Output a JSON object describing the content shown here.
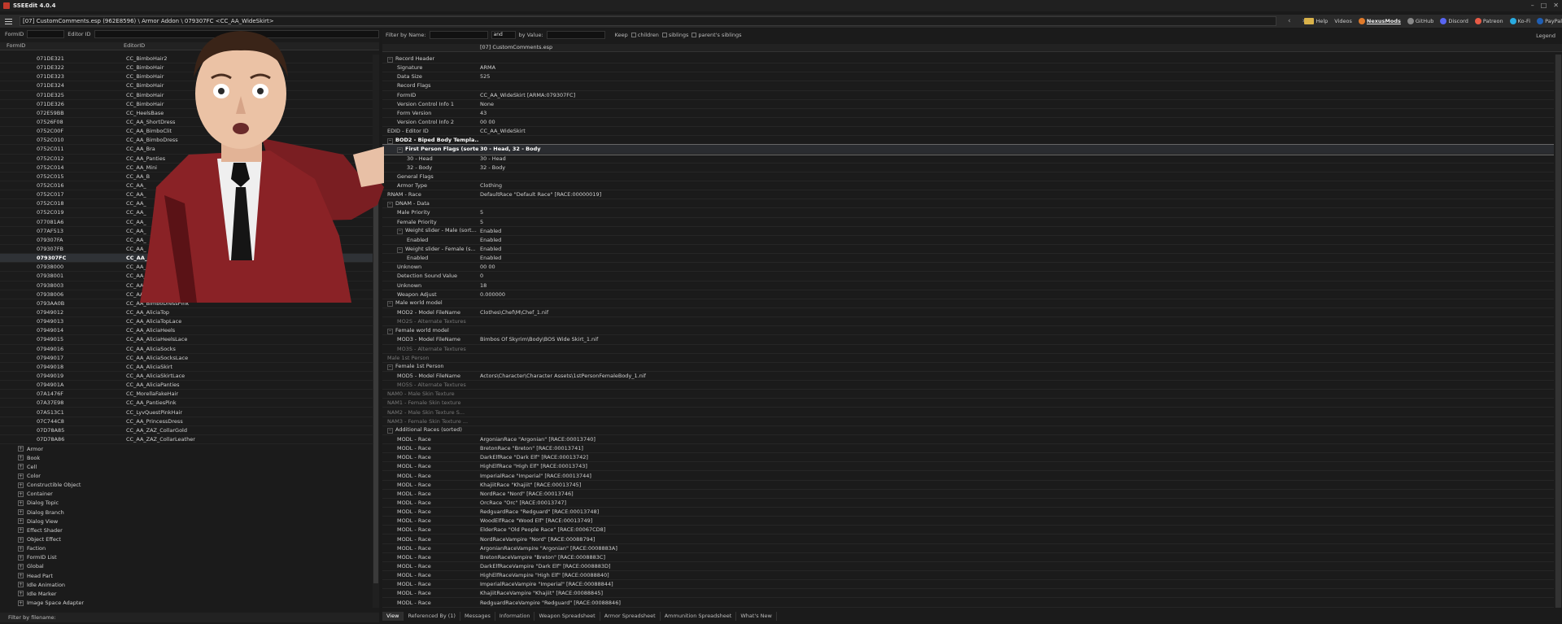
{
  "window": {
    "title": "SSEEdit 4.0.4"
  },
  "path": "[07] CustomComments.esp (962E8596) \\ Armor Addon \\ 079307FC <CC_AA_WideSkirt>",
  "top_links": [
    "Help",
    "Videos",
    "NexusMods",
    "GitHub",
    "Discord",
    "Patreon",
    "Ko-Fi",
    "PayPal"
  ],
  "left": {
    "formid_label": "FormID",
    "editorid_label": "Editor ID",
    "col_formid": "FormID",
    "col_editorid": "EditorID",
    "rows": [
      {
        "fid": "071DE321",
        "eid": "CC_BimboHair2"
      },
      {
        "fid": "071DE322",
        "eid": "CC_BimboHair"
      },
      {
        "fid": "071DE323",
        "eid": "CC_BimboHair"
      },
      {
        "fid": "071DE324",
        "eid": "CC_BimboHair"
      },
      {
        "fid": "071DE325",
        "eid": "CC_BimboHair"
      },
      {
        "fid": "071DE326",
        "eid": "CC_BimboHair"
      },
      {
        "fid": "072E59BB",
        "eid": "CC_HeelsBase"
      },
      {
        "fid": "07526F08",
        "eid": "CC_AA_ShortDress"
      },
      {
        "fid": "0752C00F",
        "eid": "CC_AA_BimboClit"
      },
      {
        "fid": "0752C010",
        "eid": "CC_AA_BimboDress"
      },
      {
        "fid": "0752C011",
        "eid": "CC_AA_Bra"
      },
      {
        "fid": "0752C012",
        "eid": "CC_AA_Panties"
      },
      {
        "fid": "0752C014",
        "eid": "CC_AA_Mini"
      },
      {
        "fid": "0752C015",
        "eid": "CC_AA_B"
      },
      {
        "fid": "0752C016",
        "eid": "CC_AA_"
      },
      {
        "fid": "0752C017",
        "eid": "CC_AA_"
      },
      {
        "fid": "0752C018",
        "eid": "CC_AA_"
      },
      {
        "fid": "0752C019",
        "eid": "CC_AA_"
      },
      {
        "fid": "077081A6",
        "eid": "CC_AA_"
      },
      {
        "fid": "077AF513",
        "eid": "CC_AA_"
      },
      {
        "fid": "079307FA",
        "eid": "CC_AA_"
      },
      {
        "fid": "079307FB",
        "eid": "CC_AA_"
      },
      {
        "fid": "079307FC",
        "eid": "CC_AA_",
        "selected": true
      },
      {
        "fid": "07938000",
        "eid": "CC_AA_"
      },
      {
        "fid": "07938001",
        "eid": "CC_AA_"
      },
      {
        "fid": "07938003",
        "eid": "CC_AA_"
      },
      {
        "fid": "07938006",
        "eid": "CC_AA_"
      },
      {
        "fid": "0793AA0B",
        "eid": "CC_AA_BimboDressPink"
      },
      {
        "fid": "07949012",
        "eid": "CC_AA_AliciaTop"
      },
      {
        "fid": "07949013",
        "eid": "CC_AA_AliciaTopLace"
      },
      {
        "fid": "07949014",
        "eid": "CC_AA_AliciaHeels"
      },
      {
        "fid": "07949015",
        "eid": "CC_AA_AliciaHeelsLace"
      },
      {
        "fid": "07949016",
        "eid": "CC_AA_AliciaSocks"
      },
      {
        "fid": "07949017",
        "eid": "CC_AA_AliciaSocksLace"
      },
      {
        "fid": "07949018",
        "eid": "CC_AA_AliciaSkirt"
      },
      {
        "fid": "07949019",
        "eid": "CC_AA_AliciaSkirtLace"
      },
      {
        "fid": "0794901A",
        "eid": "CC_AA_AliciaPanties"
      },
      {
        "fid": "07A1476F",
        "eid": "CC_MorellaFakeHair"
      },
      {
        "fid": "07A37E98",
        "eid": "CC_AA_PantiesPink"
      },
      {
        "fid": "07A513C1",
        "eid": "CC_LyvQuestPinkHair"
      },
      {
        "fid": "07C744C8",
        "eid": "CC_AA_PrincessDress"
      },
      {
        "fid": "07D78A85",
        "eid": "CC_AA_ZAZ_CollarGold"
      },
      {
        "fid": "07D78A86",
        "eid": "CC_AA_ZAZ_CollarLeather"
      }
    ],
    "groups": [
      "Armor",
      "Book",
      "Cell",
      "Color",
      "Constructible Object",
      "Container",
      "Dialog Topic",
      "Dialog Branch",
      "Dialog View",
      "Effect Shader",
      "Object Effect",
      "Faction",
      "FormID List",
      "Global",
      "Head Part",
      "Idle Animation",
      "Idle Marker",
      "Image Space Adapter"
    ],
    "bottom_filter": "Filter by filename:"
  },
  "right": {
    "filter_name_label": "Filter by Name:",
    "and_value": "and",
    "filter_value_label": "by Value:",
    "keep_label": "Keep",
    "keep_children": "children",
    "keep_siblings": "siblings",
    "keep_parents": "parent's siblings",
    "legend": "Legend",
    "column_header": "[07] CustomComments.esp",
    "rows": [
      {
        "k": "Record Header",
        "v": "",
        "ind": 0,
        "ex": "−"
      },
      {
        "k": "Signature",
        "v": "ARMA",
        "ind": 1
      },
      {
        "k": "Data Size",
        "v": "525",
        "ind": 1
      },
      {
        "k": "Record Flags",
        "v": "",
        "ind": 1
      },
      {
        "k": "FormID",
        "v": "CC_AA_WideSkirt [ARMA:079307FC]",
        "ind": 1
      },
      {
        "k": "Version Control Info 1",
        "v": "None",
        "ind": 1
      },
      {
        "k": "Form Version",
        "v": "43",
        "ind": 1
      },
      {
        "k": "Version Control Info 2",
        "v": "00 00",
        "ind": 1
      },
      {
        "k": "EDID - Editor ID",
        "v": "CC_AA_WideSkirt",
        "ind": 0
      },
      {
        "k": "BOD2 - Biped Body Templa...",
        "v": "",
        "ind": 0,
        "ex": "−",
        "bold": true
      },
      {
        "k": "First Person Flags (sorted)",
        "v": "30 - Head, 32 - Body",
        "ind": 1,
        "ex": "−",
        "hl": true
      },
      {
        "k": "30 - Head",
        "v": "30 - Head",
        "ind": 2
      },
      {
        "k": "32 - Body",
        "v": "32 - Body",
        "ind": 2
      },
      {
        "k": "General Flags",
        "v": "",
        "ind": 1
      },
      {
        "k": "Armor Type",
        "v": "Clothing",
        "ind": 1
      },
      {
        "k": "RNAM - Race",
        "v": "DefaultRace \"Default Race\" [RACE:00000019]",
        "ind": 0
      },
      {
        "k": "DNAM - Data",
        "v": "",
        "ind": 0,
        "ex": "−"
      },
      {
        "k": "Male Priority",
        "v": "5",
        "ind": 1
      },
      {
        "k": "Female Priority",
        "v": "5",
        "ind": 1
      },
      {
        "k": "Weight slider - Male (sort...",
        "v": "Enabled",
        "ind": 1,
        "ex": "−"
      },
      {
        "k": "Enabled",
        "v": "Enabled",
        "ind": 2
      },
      {
        "k": "Weight slider - Female (s...",
        "v": "Enabled",
        "ind": 1,
        "ex": "−"
      },
      {
        "k": "Enabled",
        "v": "Enabled",
        "ind": 2
      },
      {
        "k": "Unknown",
        "v": "00 00",
        "ind": 1
      },
      {
        "k": "Detection Sound Value",
        "v": "0",
        "ind": 1
      },
      {
        "k": "Unknown",
        "v": "18",
        "ind": 1
      },
      {
        "k": "Weapon Adjust",
        "v": "0.000000",
        "ind": 1
      },
      {
        "k": "Male world model",
        "v": "",
        "ind": 0,
        "ex": "−"
      },
      {
        "k": "MOD2 - Model FileName",
        "v": "Clothes\\Chef\\M\\Chef_1.nif",
        "ind": 1
      },
      {
        "k": "MO2S - Alternate Textures",
        "v": "",
        "ind": 1,
        "dim": true
      },
      {
        "k": "Female world model",
        "v": "",
        "ind": 0,
        "ex": "−"
      },
      {
        "k": "MOD3 - Model FileName",
        "v": "Bimbos Of Skyrim\\Body\\BOS Wide Skirt_1.nif",
        "ind": 1
      },
      {
        "k": "MO3S - Alternate Textures",
        "v": "",
        "ind": 1,
        "dim": true
      },
      {
        "k": "Male 1st Person",
        "v": "",
        "ind": 0,
        "dim": true
      },
      {
        "k": "Female 1st Person",
        "v": "",
        "ind": 0,
        "ex": "−"
      },
      {
        "k": "MOD5 - Model FileName",
        "v": "Actors\\Character\\Character Assets\\1stPersonFemaleBody_1.nif",
        "ind": 1
      },
      {
        "k": "MO5S - Alternate Textures",
        "v": "",
        "ind": 1,
        "dim": true
      },
      {
        "k": "NAM0 - Male Skin Texture",
        "v": "",
        "ind": 0,
        "dim": true
      },
      {
        "k": "NAM1 - Female Skin texture",
        "v": "",
        "ind": 0,
        "dim": true
      },
      {
        "k": "NAM2 - Male Skin Texture S...",
        "v": "",
        "ind": 0,
        "dim": true
      },
      {
        "k": "NAM3 - Female Skin Texture ...",
        "v": "",
        "ind": 0,
        "dim": true
      },
      {
        "k": "Additional Races (sorted)",
        "v": "",
        "ind": 0,
        "ex": "−"
      },
      {
        "k": "MODL - Race",
        "v": "ArgonianRace \"Argonian\" [RACE:00013740]",
        "ind": 1
      },
      {
        "k": "MODL - Race",
        "v": "BretonRace \"Breton\" [RACE:00013741]",
        "ind": 1
      },
      {
        "k": "MODL - Race",
        "v": "DarkElfRace \"Dark Elf\" [RACE:00013742]",
        "ind": 1
      },
      {
        "k": "MODL - Race",
        "v": "HighElfRace \"High Elf\" [RACE:00013743]",
        "ind": 1
      },
      {
        "k": "MODL - Race",
        "v": "ImperialRace \"Imperial\" [RACE:00013744]",
        "ind": 1
      },
      {
        "k": "MODL - Race",
        "v": "KhajiitRace \"Khajiit\" [RACE:00013745]",
        "ind": 1
      },
      {
        "k": "MODL - Race",
        "v": "NordRace \"Nord\" [RACE:00013746]",
        "ind": 1
      },
      {
        "k": "MODL - Race",
        "v": "OrcRace \"Orc\" [RACE:00013747]",
        "ind": 1
      },
      {
        "k": "MODL - Race",
        "v": "RedguardRace \"Redguard\" [RACE:00013748]",
        "ind": 1
      },
      {
        "k": "MODL - Race",
        "v": "WoodElfRace \"Wood Elf\" [RACE:00013749]",
        "ind": 1
      },
      {
        "k": "MODL - Race",
        "v": "ElderRace \"Old People Race\" [RACE:00067CD8]",
        "ind": 1
      },
      {
        "k": "MODL - Race",
        "v": "NordRaceVampire \"Nord\" [RACE:00088794]",
        "ind": 1
      },
      {
        "k": "MODL - Race",
        "v": "ArgonianRaceVampire \"Argonian\" [RACE:0008883A]",
        "ind": 1
      },
      {
        "k": "MODL - Race",
        "v": "BretonRaceVampire \"Breton\" [RACE:0008883C]",
        "ind": 1
      },
      {
        "k": "MODL - Race",
        "v": "DarkElfRaceVampire \"Dark Elf\" [RACE:0008883D]",
        "ind": 1
      },
      {
        "k": "MODL - Race",
        "v": "HighElfRaceVampire \"High Elf\" [RACE:00088840]",
        "ind": 1
      },
      {
        "k": "MODL - Race",
        "v": "ImperialRaceVampire \"Imperial\" [RACE:00088844]",
        "ind": 1
      },
      {
        "k": "MODL - Race",
        "v": "KhajiitRaceVampire \"Khajiit\" [RACE:00088845]",
        "ind": 1
      },
      {
        "k": "MODL - Race",
        "v": "RedguardRaceVampire \"Redguard\" [RACE:00088846]",
        "ind": 1
      }
    ],
    "tabs": [
      "View",
      "Referenced By (1)",
      "Messages",
      "Information",
      "Weapon Spreadsheet",
      "Armor Spreadsheet",
      "Ammunition Spreadsheet",
      "What's New"
    ]
  }
}
